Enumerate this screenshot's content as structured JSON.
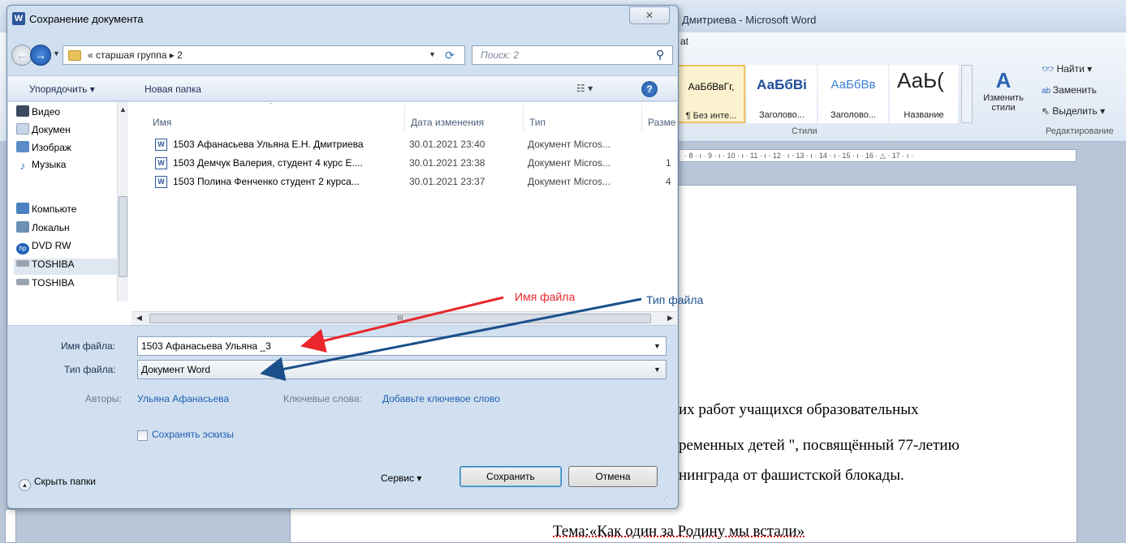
{
  "colors": {
    "annotation_red": "#e8262b",
    "annotation_blue": "#1a4f8b",
    "link_blue": "#1f5fb0"
  },
  "word": {
    "title": "Дмитриева - Microsoft Word",
    "tab_fragment": "at",
    "styles": {
      "no_spacing_sample": "АаБбВвГг,",
      "no_spacing_name": "¶ Без инте...",
      "heading1_sample": "АаБбВі",
      "heading1_name": "Заголово...",
      "heading2_sample": "АаБбВв",
      "heading2_name": "Заголово...",
      "title_sample": "АаЬ(",
      "title_name": "Название",
      "change_styles_label": "Изменить стили",
      "group_label": "Стили"
    },
    "editing": {
      "find_label": "Найти ▾",
      "replace_label": "Заменить",
      "select_label": "Выделить ▾",
      "group_label": "Редактирование"
    },
    "ruler_text": "· 8 · ı · 9 · ı · 10 · ı · 11 · ı · 12 · ı · 13 · ı · 14 · ı · 15 · ı · 16 · △ · 17 · ı ·",
    "document_lines": [
      "их работ учащихся образовательных",
      "ременных детей \", посвящённый 77-летию",
      "нинграда от фашистской блокады.",
      "Тема:«Как один за Родину мы встали»"
    ]
  },
  "annotations": {
    "filename_label": "Имя файла",
    "filetype_label": "Тип файла"
  },
  "dialog": {
    "title": "Сохранение документа",
    "app_icon": "W",
    "close_icon": "close-icon",
    "address_path": "«  старшая группа  ▸  2",
    "search_placeholder": "Поиск: 2",
    "toolbar": {
      "organize_label": "Упорядочить ▾",
      "new_folder_label": "Новая папка",
      "help_label": "?"
    },
    "nav_items": [
      {
        "label": "Видео",
        "icon": "video-icon",
        "color": "#3b4a5e"
      },
      {
        "label": "Докумен",
        "icon": "documents-icon",
        "color": "#c9d6e6"
      },
      {
        "label": "Изображ",
        "icon": "pictures-icon",
        "color": "#5b8cc7"
      },
      {
        "label": "Музыка",
        "icon": "music-icon",
        "color": "#2c6fc2"
      },
      {
        "label": "Компьюте",
        "icon": "computer-icon",
        "color": "#4a7fc1"
      },
      {
        "label": "Локальн",
        "icon": "local-disk-icon",
        "color": "#6c8fb5"
      },
      {
        "label": "DVD RW",
        "icon": "dvd-drive-icon",
        "color": "#2062b8"
      },
      {
        "label": "TOSHIBA",
        "icon": "usb-drive-icon",
        "color": "#9aa4b0"
      },
      {
        "label": "TOSHIBA",
        "icon": "usb-drive-icon",
        "color": "#9aa4b0"
      }
    ],
    "columns": {
      "name": "Имя",
      "date": "Дата изменения",
      "type": "Тип",
      "size": "Разме"
    },
    "files": [
      {
        "name": "1503 Афанасьева Ульяна Е.Н. Дмитриева",
        "date": "30.01.2021 23:40",
        "type": "Документ Micros...",
        "size": ""
      },
      {
        "name": "1503 Демчук Валерия, студент 4 курс Е....",
        "date": "30.01.2021 23:38",
        "type": "Документ Micros...",
        "size": "1"
      },
      {
        "name": "1503 Полина Фенченко студент 2 курса...",
        "date": "30.01.2021 23:37",
        "type": "Документ Micros...",
        "size": "4"
      }
    ],
    "scroll_grip": "III",
    "form": {
      "filename_label": "Имя файла:",
      "filename_value": "1503 Афанасьева Ульяна _3",
      "filetype_label": "Тип файла:",
      "filetype_value": "Документ Word",
      "authors_label": "Авторы:",
      "authors_value": "Ульяна Афанасьева",
      "keywords_label": "Ключевые слова:",
      "keywords_value": "Добавьте ключевое слово",
      "thumbnails_label": "Сохранять эскизы"
    },
    "buttons": {
      "hide_folders": "Скрыть папки",
      "tools": "Сервис  ▾",
      "save": "Сохранить",
      "cancel": "Отмена"
    }
  }
}
